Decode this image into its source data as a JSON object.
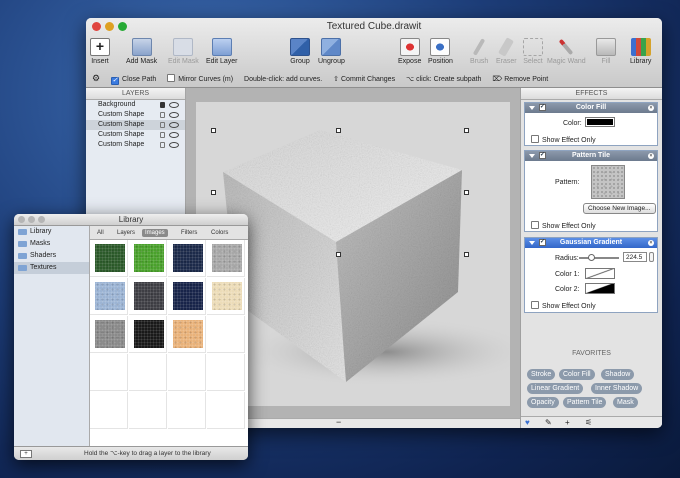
{
  "window": {
    "title": "Textured Cube.drawit"
  },
  "toolbar": [
    {
      "label": "Insert",
      "icon": "insert-icon",
      "enabled": true
    },
    {
      "label": "Add Mask",
      "icon": "add-mask-icon",
      "enabled": true
    },
    {
      "label": "Edit Mask",
      "icon": "edit-mask-icon",
      "enabled": false
    },
    {
      "label": "Edit Layer",
      "icon": "edit-layer-icon",
      "enabled": true
    },
    {
      "label": "Group",
      "icon": "group-icon",
      "enabled": true
    },
    {
      "label": "Ungroup",
      "icon": "ungroup-icon",
      "enabled": true
    },
    {
      "label": "Expose",
      "icon": "expose-icon",
      "enabled": true
    },
    {
      "label": "Position",
      "icon": "position-icon",
      "enabled": true
    },
    {
      "label": "Brush",
      "icon": "brush-icon",
      "enabled": false
    },
    {
      "label": "Eraser",
      "icon": "eraser-icon",
      "enabled": false
    },
    {
      "label": "Select",
      "icon": "select-icon",
      "enabled": false
    },
    {
      "label": "Magic Wand",
      "icon": "magic-wand-icon",
      "enabled": false
    },
    {
      "label": "Fill",
      "icon": "fill-icon",
      "enabled": false
    },
    {
      "label": "Library",
      "icon": "library-icon",
      "enabled": true
    }
  ],
  "options": {
    "close_path": "Close Path",
    "mirror_curves": "Mirror Curves (m)",
    "hint1": "Double-click: add curves.",
    "hint2_key": "⇧",
    "hint2": "Commit Changes",
    "hint3_key": "⌥",
    "hint3": "click: Create subpath",
    "hint4_key": "⌦",
    "hint4": "Remove Point"
  },
  "layers_panel": {
    "header": "LAYERS",
    "items": [
      {
        "name": "Background",
        "locked": true,
        "selected": false
      },
      {
        "name": "Custom Shape",
        "locked": false,
        "selected": false
      },
      {
        "name": "Custom Shape",
        "locked": false,
        "selected": true
      },
      {
        "name": "Custom Shape",
        "locked": false,
        "selected": false
      },
      {
        "name": "Custom Shape",
        "locked": false,
        "selected": false
      }
    ]
  },
  "effects_panel": {
    "header": "EFFECTS",
    "color_fill": {
      "title": "Color Fill",
      "color_label": "Color:",
      "color": "#000000",
      "show_only": "Show Effect Only"
    },
    "pattern_tile": {
      "title": "Pattern Tile",
      "pattern_label": "Pattern:",
      "choose_button": "Choose New Image...",
      "show_only": "Show Effect Only"
    },
    "gaussian": {
      "title": "Gaussian Gradient",
      "radius_label": "Radius:",
      "radius_value": "224.5",
      "radius_fraction": 0.3,
      "color1_label": "Color 1:",
      "color2_label": "Color 2:",
      "show_only": "Show Effect Only"
    }
  },
  "favorites": {
    "header": "FAVORITES",
    "items": [
      "Stroke",
      "Color Fill",
      "Shadow",
      "Linear Gradient",
      "Inner Shadow",
      "Opacity",
      "Pattern Tile",
      "Mask"
    ]
  },
  "library": {
    "title": "Library",
    "sidebar": [
      {
        "label": "Library",
        "selected": false
      },
      {
        "label": "Masks",
        "selected": false
      },
      {
        "label": "Shaders",
        "selected": false
      },
      {
        "label": "Textures",
        "selected": true
      }
    ],
    "tabs": [
      {
        "label": "All",
        "selected": false
      },
      {
        "label": "Layers",
        "selected": false
      },
      {
        "label": "Images",
        "selected": true
      },
      {
        "label": "Filters",
        "selected": false
      },
      {
        "label": "Colors",
        "selected": false
      }
    ],
    "swatches": [
      "#2c5a2a",
      "#4aa12c",
      "#1c2a4a",
      "#a8a8a8",
      "#9cb4d4",
      "#3e3e44",
      "#18244a",
      "#ecdcb8",
      "#8a8a8a",
      "#1a1a1a",
      "#e9b27a"
    ],
    "footer": "Hold the ⌥-key to drag a layer to the library"
  }
}
